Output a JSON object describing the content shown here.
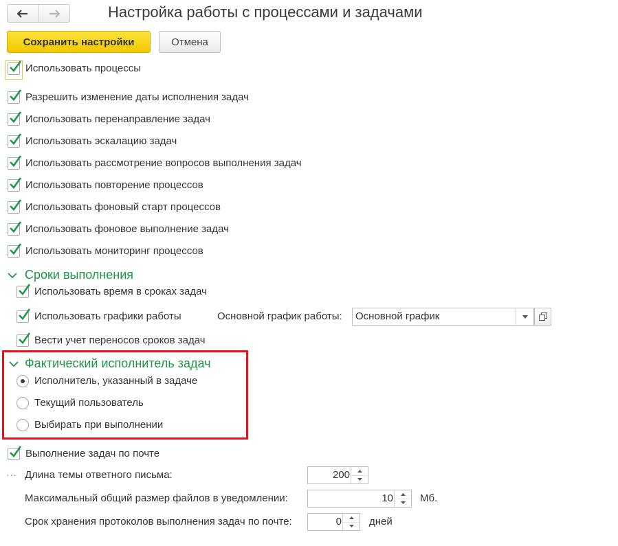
{
  "window": {
    "title": "Настройка работы с процессами и задачами"
  },
  "toolbar": {
    "save_label": "Сохранить настройки",
    "cancel_label": "Отмена"
  },
  "colors": {
    "accent_green": "#1f9748",
    "save_button_yellow": "#f7d417",
    "highlight_red": "#e8101a"
  },
  "main_options": [
    {
      "label": "Использовать процессы",
      "checked": true
    },
    {
      "label": "Разрешить изменение даты исполнения задач",
      "checked": true
    },
    {
      "label": "Использовать перенаправление задач",
      "checked": true
    },
    {
      "label": "Использовать эскалацию задач",
      "checked": true
    },
    {
      "label": "Использовать рассмотрение вопросов выполнения задач",
      "checked": true
    },
    {
      "label": "Использовать повторение процессов",
      "checked": true
    },
    {
      "label": "Использовать фоновый старт процессов",
      "checked": true
    },
    {
      "label": "Использовать фоновое выполнение задач",
      "checked": true
    },
    {
      "label": "Использовать мониторинг процессов",
      "checked": true
    }
  ],
  "deadlines": {
    "title": "Сроки выполнения",
    "options": [
      {
        "label": "Использовать время в сроках задач",
        "checked": true
      },
      {
        "label": "Использовать графики работы",
        "checked": true
      },
      {
        "label": "Вести учет переносов сроков задач",
        "checked": true
      }
    ],
    "schedule_label": "Основной график работы:",
    "schedule_value": "Основной график"
  },
  "actual_performer": {
    "title": "Фактический исполнитель задач",
    "options": [
      {
        "label": "Исполнитель, указанный в задаче",
        "selected": true
      },
      {
        "label": "Текущий пользователь",
        "selected": false
      },
      {
        "label": "Выбирать при выполнении",
        "selected": false
      }
    ]
  },
  "mail": {
    "label": "Выполнение задач по почте",
    "checked": true,
    "dots": "···",
    "reply_subject_label": "Длина темы ответного письма:",
    "reply_subject_value": "200",
    "max_files_label": "Максимальный общий размер файлов в уведомлении:",
    "max_files_value": "10",
    "max_files_unit": "Мб.",
    "log_retention_label": "Срок хранения протоколов выполнения задач по почте:",
    "log_retention_value": "0",
    "log_retention_unit": "дней"
  }
}
